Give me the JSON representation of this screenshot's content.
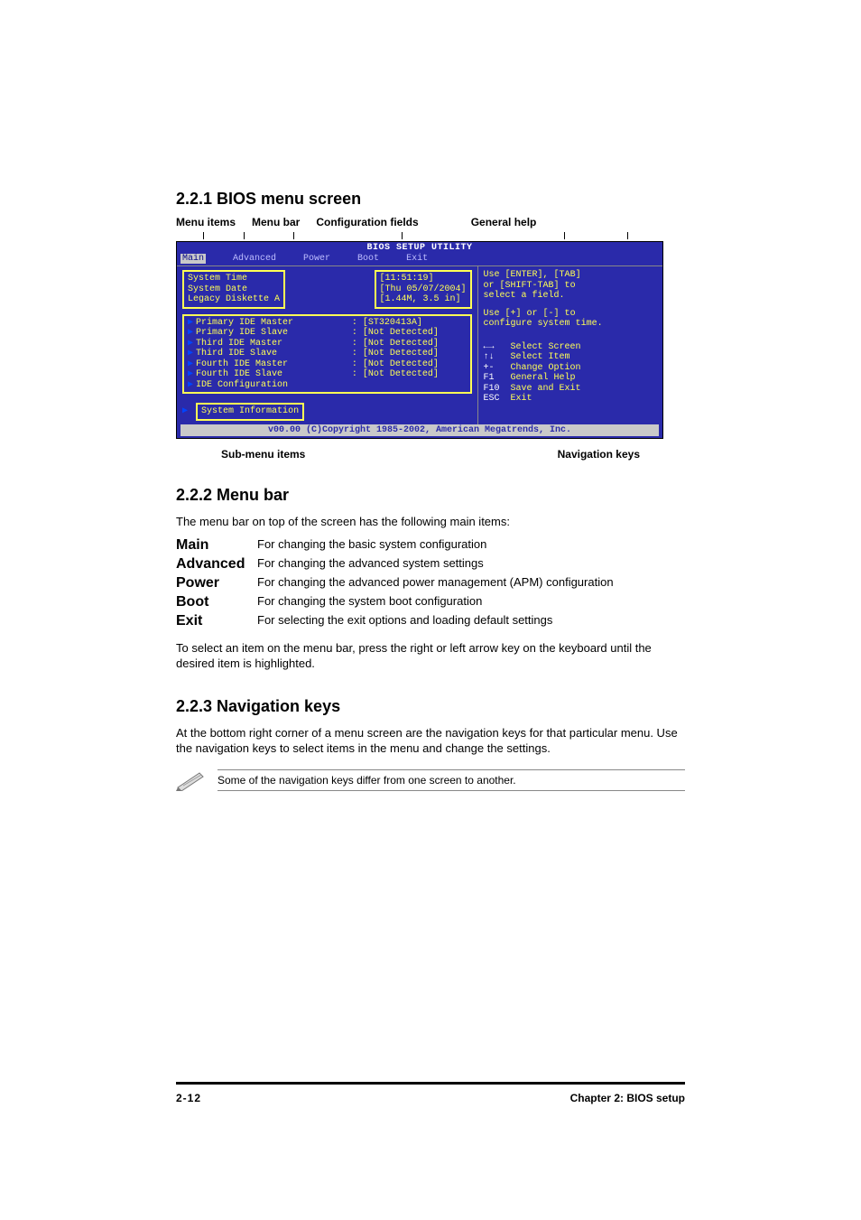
{
  "sections": {
    "s1": "2.2.1   BIOS menu screen",
    "s2": "2.2.2   Menu bar",
    "s3": "2.2.3   Navigation keys"
  },
  "top_labels": {
    "menu_items": "Menu items",
    "menu_bar": "Menu bar",
    "config_fields": "Configuration fields",
    "general_help": "General help"
  },
  "bios": {
    "title": "BIOS SETUP UTILITY",
    "menu": {
      "main": "Main",
      "advanced": "Advanced",
      "power": "Power",
      "boot": "Boot",
      "exit": "Exit"
    },
    "left_block1": {
      "system_time": "System Time",
      "system_date": "System Date",
      "legacy": "Legacy Diskette A"
    },
    "vals_block1": {
      "time": "[11:51:19]",
      "date": "[Thu 05/07/2004]",
      "legacy": "[1.44M, 3.5 in]"
    },
    "sub_items": [
      {
        "label": "Primary IDE Master",
        "value": ": [ST320413A]"
      },
      {
        "label": "Primary IDE Slave",
        "value": ": [Not Detected]"
      },
      {
        "label": "Third IDE Master",
        "value": ": [Not Detected]"
      },
      {
        "label": "Third IDE Slave",
        "value": ": [Not Detected]"
      },
      {
        "label": "Fourth IDE Master",
        "value": ": [Not Detected]"
      },
      {
        "label": "Fourth IDE Slave",
        "value": ": [Not Detected]"
      },
      {
        "label": "IDE Configuration",
        "value": ""
      }
    ],
    "sys_info": "System Information",
    "help1": "Use [ENTER], [TAB]",
    "help2": "or [SHIFT-TAB] to",
    "help3": "select a field.",
    "help4": "Use [+] or [-] to",
    "help5": "configure system time.",
    "nav": [
      {
        "key": "←→",
        "desc": "Select Screen"
      },
      {
        "key": "↑↓",
        "desc": "Select Item"
      },
      {
        "key": "+-",
        "desc": "Change Option"
      },
      {
        "key": "F1",
        "desc": "General Help"
      },
      {
        "key": "F10",
        "desc": "Save and Exit"
      },
      {
        "key": "ESC",
        "desc": "Exit"
      }
    ],
    "copyright": "v00.00 (C)Copyright 1985-2002, American Megatrends, Inc."
  },
  "bottom_labels": {
    "sub": "Sub-menu items",
    "nav": "Navigation keys"
  },
  "menubar_intro": "The menu bar on top of the screen has the following main items:",
  "menubar_defs": {
    "main_k": "Main",
    "main_v": "For changing the basic system configuration",
    "adv_k": "Advanced",
    "adv_v": "For changing the advanced system settings",
    "pow_k": "Power",
    "pow_v": "For changing the advanced power management (APM) configuration",
    "boot_k": "Boot",
    "boot_v": "For changing the system boot configuration",
    "exit_k": "Exit",
    "exit_v": "For selecting the exit options and loading default settings"
  },
  "menubar_after": "To select an item on the menu bar, press the right or left arrow key on the keyboard until the desired item is highlighted.",
  "navkeys_text": "At the bottom right corner of a menu screen are the navigation keys for that particular menu. Use the navigation keys to select items in the menu and change the settings.",
  "note": "Some of the navigation keys differ from one screen to another.",
  "footer": {
    "page": "2-12",
    "chapter": "Chapter 2: BIOS setup"
  }
}
